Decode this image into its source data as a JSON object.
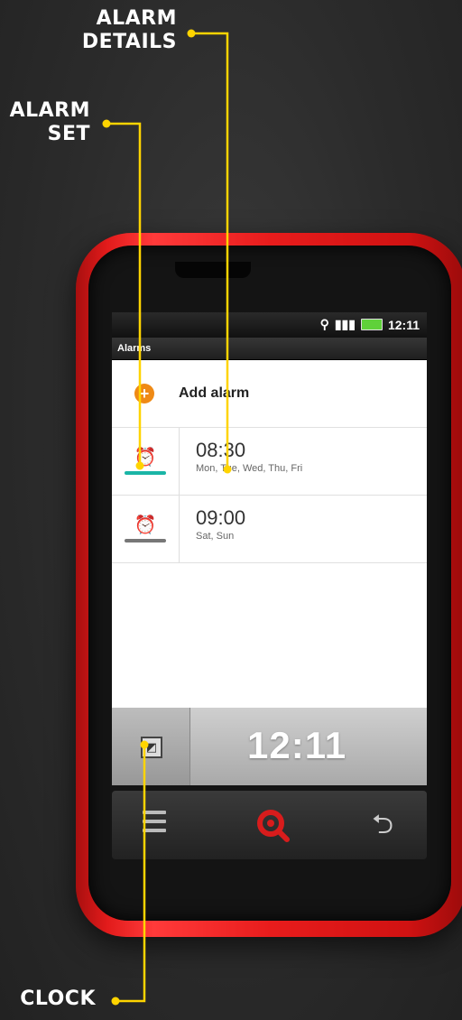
{
  "callouts": {
    "alarm_details": [
      "ALARM",
      "DETAILS"
    ],
    "alarm_set": [
      "ALARM",
      "SET"
    ],
    "clock": "CLOCK"
  },
  "status_bar": {
    "time": "12:11"
  },
  "app": {
    "title": "Alarms"
  },
  "add_alarm": {
    "label": "Add alarm",
    "icon": "plus-icon"
  },
  "alarms": [
    {
      "time": "08:30",
      "days": "Mon, Tue, Wed, Thu, Fri",
      "enabled": true,
      "icon": "alarm-clock-icon",
      "color": "#1ab5a6"
    },
    {
      "time": "09:00",
      "days": "Sat, Sun",
      "enabled": false,
      "icon": "alarm-clock-icon",
      "color": "#777777"
    }
  ],
  "clock_widget": {
    "time": "12:11",
    "icon": "clock-widget-icon"
  },
  "nav": {
    "menu": "menu-icon",
    "search": "search-icon",
    "back": "back-icon"
  },
  "colors": {
    "phone": "#e21b1b",
    "accent_orange": "#ef8a16",
    "callout_line": "#ffd400"
  }
}
